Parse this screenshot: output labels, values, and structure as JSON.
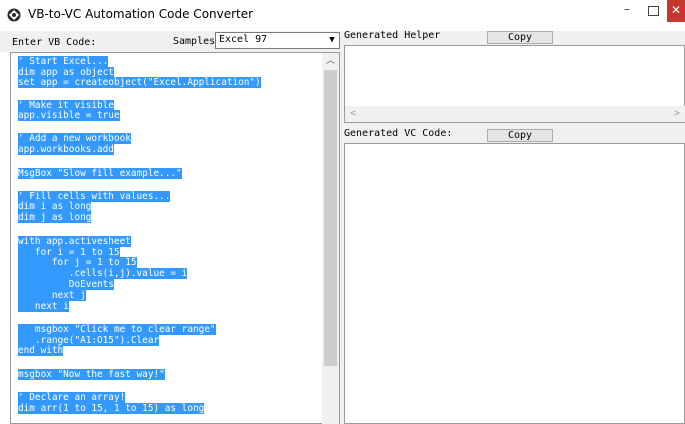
{
  "window": {
    "title": "VB-to-VC Automation Code Converter",
    "icon": "app-icon",
    "controls": {
      "minimize": "–",
      "close": "✕"
    },
    "close_color": "#c7372f"
  },
  "left": {
    "label": "Enter VB Code:",
    "samples_label": "Samples",
    "samples_value": "Excel 97",
    "selection_color": "#3399ff",
    "code_lines": [
      "' Start Excel...",
      "dim app as object",
      "set app = createobject(\"Excel.Application\")",
      "' Make it visible",
      "app.visible = true",
      "' Add a new workbook",
      "app.workbooks.add",
      "MsgBox \"Slow fill example...\"",
      "' Fill cells with values...",
      "dim i as long",
      "dim j as long",
      "with app.activesheet",
      "   for i = 1 to 15",
      "      for j = 1 to 15",
      "         .cells(i,j).value = i",
      "         DoEvents",
      "      next j",
      "   next i",
      "   msgbox \"Click me to clear range\"",
      "   .range(\"A1:O15\").Clear",
      "end with",
      "msgbox \"Now the fast way!\"",
      "' Declare an array!",
      "dim arr(1 to 15, 1 to 15) as long"
    ]
  },
  "right": {
    "helper_label": "Generated Helper",
    "helper_copy": "Copy",
    "vc_label": "Generated VC Code:",
    "vc_copy": "Copy"
  }
}
